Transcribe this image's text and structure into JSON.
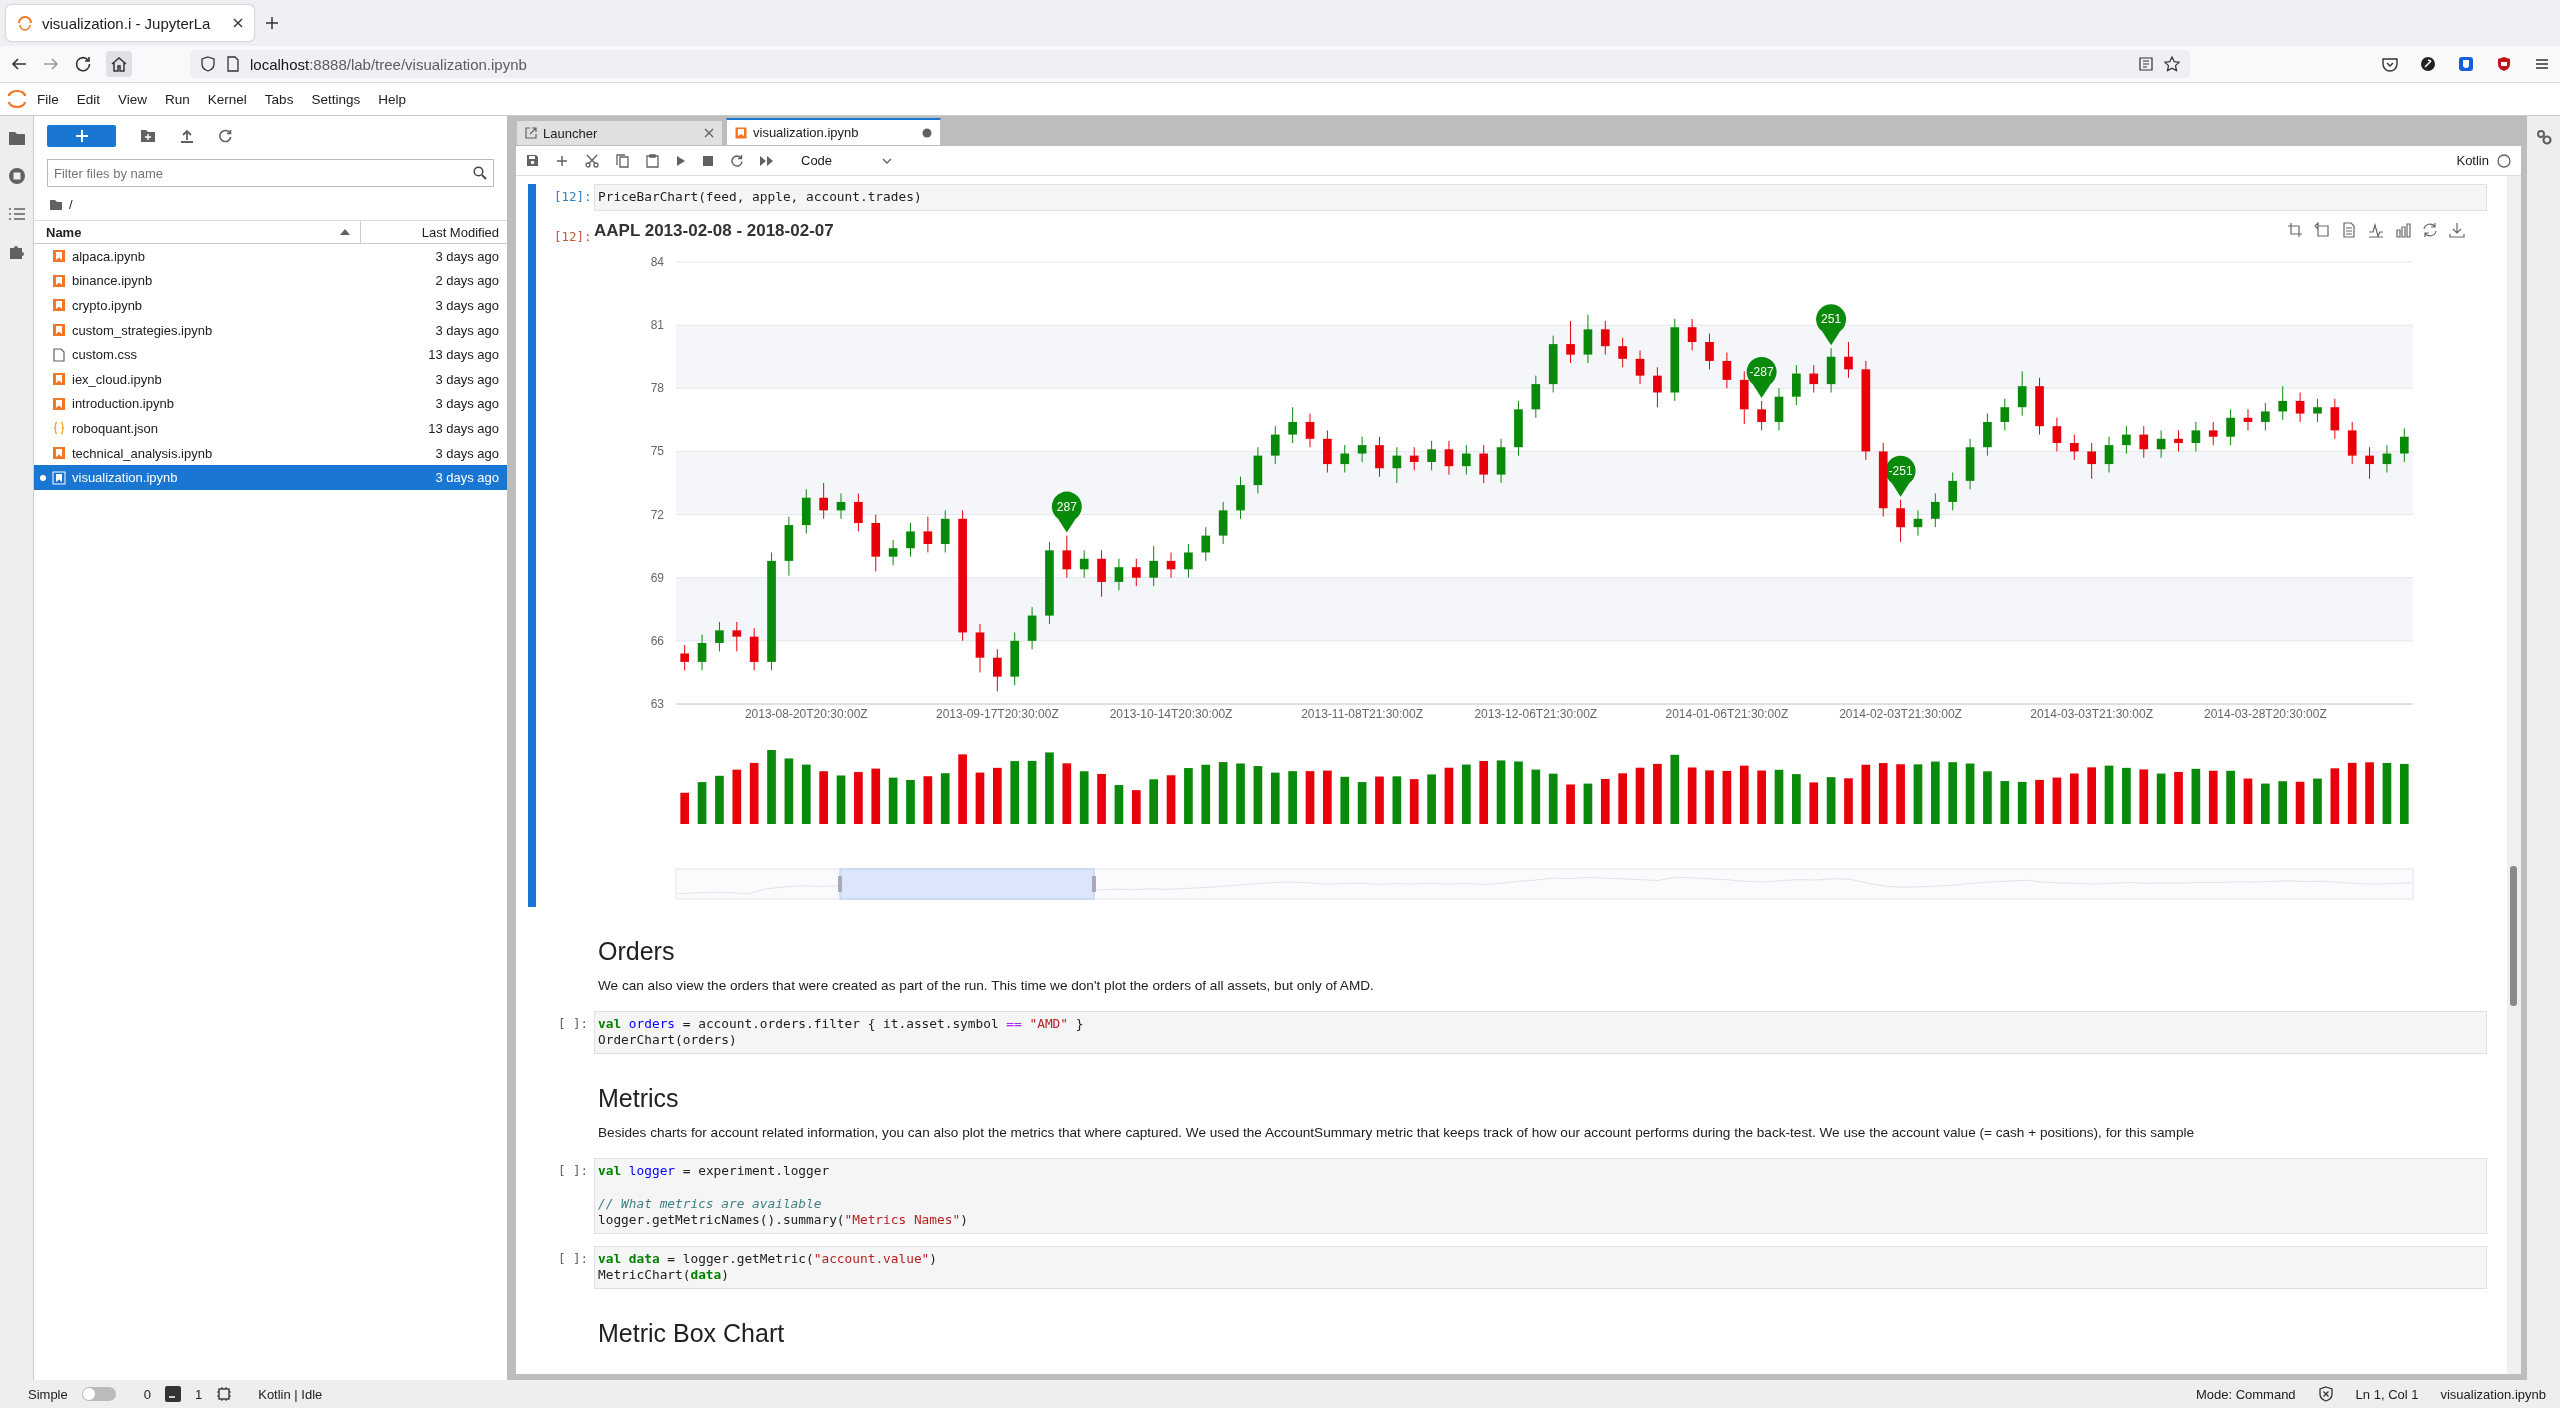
{
  "browser": {
    "tab_title": "visualization.i - JupyterLa",
    "url_host": "localhost",
    "url_path": ":8888/lab/tree/visualization.ipynb"
  },
  "menu": [
    "File",
    "Edit",
    "View",
    "Run",
    "Kernel",
    "Tabs",
    "Settings",
    "Help"
  ],
  "file_browser": {
    "filter_placeholder": "Filter files by name",
    "path": "/",
    "columns": [
      "Name",
      "Last Modified"
    ],
    "files": [
      {
        "name": "alpaca.ipynb",
        "modified": "3 days ago",
        "kind": "notebook",
        "selected": false
      },
      {
        "name": "binance.ipynb",
        "modified": "2 days ago",
        "kind": "notebook",
        "selected": false
      },
      {
        "name": "crypto.ipynb",
        "modified": "3 days ago",
        "kind": "notebook",
        "selected": false
      },
      {
        "name": "custom_strategies.ipynb",
        "modified": "3 days ago",
        "kind": "notebook",
        "selected": false
      },
      {
        "name": "custom.css",
        "modified": "13 days ago",
        "kind": "file",
        "selected": false
      },
      {
        "name": "iex_cloud.ipynb",
        "modified": "3 days ago",
        "kind": "notebook",
        "selected": false
      },
      {
        "name": "introduction.ipynb",
        "modified": "3 days ago",
        "kind": "notebook",
        "selected": false
      },
      {
        "name": "roboquant.json",
        "modified": "13 days ago",
        "kind": "json",
        "selected": false
      },
      {
        "name": "technical_analysis.ipynb",
        "modified": "3 days ago",
        "kind": "notebook",
        "selected": false
      },
      {
        "name": "visualization.ipynb",
        "modified": "3 days ago",
        "kind": "notebook",
        "selected": true
      }
    ]
  },
  "notebook_tabs": [
    {
      "label": "Launcher",
      "kind": "launcher",
      "selected": false
    },
    {
      "label": "visualization.ipynb",
      "kind": "notebook",
      "selected": true
    }
  ],
  "toolbar": {
    "cell_type": "Code",
    "kernel": "Kotlin"
  },
  "cells": [
    {
      "kind": "code",
      "prompt": "[12]:",
      "selected": true,
      "lines": [
        {
          "kind": "code",
          "tokens": [
            {
              "text": "PriceBarChart(feed, apple, account.trades)",
              "kind": "plain"
            }
          ]
        }
      ],
      "output": {
        "prompt": "[12]:",
        "chart_data": {
          "type": "candlestick",
          "title": "AAPL 2013-02-08 - 2018-02-07",
          "ylim": [
            63,
            84
          ],
          "yticks": [
            63,
            66,
            69,
            72,
            75,
            78,
            81,
            84
          ],
          "grid": true,
          "categories": [
            null,
            null,
            null,
            null,
            null,
            null,
            null,
            "2013-08-20T20:30:00Z",
            null,
            null,
            null,
            null,
            null,
            null,
            null,
            null,
            null,
            null,
            "2013-09-17T20:30:00Z",
            null,
            null,
            null,
            null,
            null,
            null,
            null,
            null,
            null,
            "2013-10-14T20:30:00Z",
            null,
            null,
            null,
            null,
            null,
            null,
            null,
            null,
            null,
            null,
            "2013-11-08T21:30:00Z",
            null,
            null,
            null,
            null,
            null,
            null,
            null,
            null,
            null,
            "2013-12-06T21:30:00Z",
            null,
            null,
            null,
            null,
            null,
            null,
            null,
            null,
            null,
            null,
            "2014-01-06T21:30:00Z",
            null,
            null,
            null,
            null,
            null,
            null,
            null,
            null,
            null,
            "2014-02-03T21:30:00Z",
            null,
            null,
            null,
            null,
            null,
            null,
            null,
            null,
            null,
            null,
            "2014-03-03T21:30:00Z",
            null,
            null,
            null,
            null,
            null,
            null,
            null,
            null,
            null,
            "2014-03-28T20:30:00Z",
            null,
            null,
            null,
            null,
            null,
            null,
            null,
            null
          ],
          "annotations": [
            "287",
            "-287",
            "251",
            "-251"
          ],
          "ohlc": [
            [
              65.4,
              65.8,
              64.6,
              65.0
            ],
            [
              65.0,
              66.3,
              64.6,
              65.9
            ],
            [
              65.9,
              66.9,
              65.5,
              66.5
            ],
            [
              66.5,
              66.9,
              65.5,
              66.2
            ],
            [
              66.2,
              66.6,
              64.6,
              65.0
            ],
            [
              65.0,
              70.2,
              64.6,
              69.8
            ],
            [
              69.8,
              71.9,
              69.1,
              71.5
            ],
            [
              71.5,
              73.2,
              71.1,
              72.8
            ],
            [
              72.8,
              73.5,
              71.8,
              72.2
            ],
            [
              72.2,
              73.0,
              71.8,
              72.6
            ],
            [
              72.6,
              73.0,
              71.2,
              71.6
            ],
            [
              71.6,
              72.0,
              69.3,
              70.0
            ],
            [
              70.0,
              70.8,
              69.6,
              70.4
            ],
            [
              70.4,
              71.6,
              70.0,
              71.2
            ],
            [
              71.2,
              71.9,
              70.2,
              70.6
            ],
            [
              70.6,
              72.2,
              70.2,
              71.8
            ],
            [
              71.8,
              72.2,
              66.0,
              66.4
            ],
            [
              66.4,
              66.8,
              64.5,
              65.2
            ],
            [
              65.2,
              65.6,
              63.6,
              64.3
            ],
            [
              64.3,
              66.4,
              63.9,
              66.0
            ],
            [
              66.0,
              67.6,
              65.6,
              67.2
            ],
            [
              67.2,
              70.7,
              66.8,
              70.3
            ],
            [
              70.3,
              71.0,
              69.0,
              69.4
            ],
            [
              69.4,
              70.3,
              69.0,
              69.9
            ],
            [
              69.9,
              70.3,
              68.1,
              68.8
            ],
            [
              68.8,
              69.9,
              68.4,
              69.5
            ],
            [
              69.5,
              69.9,
              68.6,
              69.0
            ],
            [
              69.0,
              70.5,
              68.6,
              69.8
            ],
            [
              69.8,
              70.2,
              69.0,
              69.4
            ],
            [
              69.4,
              70.6,
              69.0,
              70.2
            ],
            [
              70.2,
              71.4,
              69.8,
              71.0
            ],
            [
              71.0,
              72.6,
              70.6,
              72.2
            ],
            [
              72.2,
              73.8,
              71.8,
              73.4
            ],
            [
              73.4,
              75.2,
              73.0,
              74.8
            ],
            [
              74.8,
              76.2,
              74.4,
              75.8
            ],
            [
              75.8,
              77.1,
              75.4,
              76.4
            ],
            [
              76.4,
              76.8,
              75.2,
              75.6
            ],
            [
              75.6,
              76.0,
              74.0,
              74.4
            ],
            [
              74.4,
              75.3,
              74.0,
              74.9
            ],
            [
              74.9,
              75.7,
              74.5,
              75.3
            ],
            [
              75.3,
              75.7,
              73.8,
              74.2
            ],
            [
              74.2,
              75.2,
              73.5,
              74.8
            ],
            [
              74.8,
              75.2,
              74.1,
              74.5
            ],
            [
              74.5,
              75.5,
              74.1,
              75.1
            ],
            [
              75.1,
              75.5,
              73.9,
              74.3
            ],
            [
              74.3,
              75.3,
              73.9,
              74.9
            ],
            [
              74.9,
              75.3,
              73.5,
              73.9
            ],
            [
              73.9,
              75.6,
              73.5,
              75.2
            ],
            [
              75.2,
              77.4,
              74.8,
              77.0
            ],
            [
              77.0,
              78.6,
              76.6,
              78.2
            ],
            [
              78.2,
              80.5,
              77.8,
              80.1
            ],
            [
              80.1,
              81.2,
              79.2,
              79.6
            ],
            [
              79.6,
              81.5,
              79.2,
              80.8
            ],
            [
              80.8,
              81.2,
              79.6,
              80.0
            ],
            [
              80.0,
              80.4,
              79.0,
              79.4
            ],
            [
              79.4,
              79.8,
              78.2,
              78.6
            ],
            [
              78.6,
              79.0,
              77.1,
              77.8
            ],
            [
              77.8,
              81.3,
              77.4,
              80.9
            ],
            [
              80.9,
              81.3,
              79.8,
              80.2
            ],
            [
              80.2,
              80.6,
              78.9,
              79.3
            ],
            [
              79.3,
              79.7,
              78.0,
              78.4
            ],
            [
              78.4,
              78.8,
              76.3,
              77.0
            ],
            [
              77.0,
              77.4,
              76.0,
              76.4
            ],
            [
              76.4,
              78.0,
              76.0,
              77.6
            ],
            [
              77.6,
              79.1,
              77.2,
              78.7
            ],
            [
              78.7,
              79.1,
              77.8,
              78.2
            ],
            [
              78.2,
              79.9,
              77.8,
              79.5
            ],
            [
              79.5,
              80.2,
              78.5,
              78.9
            ],
            [
              78.9,
              79.3,
              74.6,
              75.0
            ],
            [
              75.0,
              75.4,
              71.9,
              72.3
            ],
            [
              72.3,
              72.7,
              70.7,
              71.4
            ],
            [
              71.4,
              72.2,
              71.0,
              71.8
            ],
            [
              71.8,
              73.0,
              71.4,
              72.6
            ],
            [
              72.6,
              74.0,
              72.2,
              73.6
            ],
            [
              73.6,
              75.6,
              73.2,
              75.2
            ],
            [
              75.2,
              76.8,
              74.8,
              76.4
            ],
            [
              76.4,
              77.5,
              76.0,
              77.1
            ],
            [
              77.1,
              78.8,
              76.7,
              78.1
            ],
            [
              78.1,
              78.5,
              75.8,
              76.2
            ],
            [
              76.2,
              76.6,
              75.0,
              75.4
            ],
            [
              75.4,
              75.8,
              74.6,
              75.0
            ],
            [
              75.0,
              75.4,
              73.7,
              74.4
            ],
            [
              74.4,
              75.7,
              74.0,
              75.3
            ],
            [
              75.3,
              76.2,
              74.9,
              75.8
            ],
            [
              75.8,
              76.2,
              74.7,
              75.1
            ],
            [
              75.1,
              76.0,
              74.7,
              75.6
            ],
            [
              75.6,
              76.0,
              75.0,
              75.4
            ],
            [
              75.4,
              76.4,
              75.0,
              76.0
            ],
            [
              76.0,
              76.4,
              75.3,
              75.7
            ],
            [
              75.7,
              77.0,
              75.3,
              76.6
            ],
            [
              76.6,
              77.0,
              76.0,
              76.4
            ],
            [
              76.4,
              77.3,
              76.0,
              76.9
            ],
            [
              76.9,
              78.1,
              76.5,
              77.4
            ],
            [
              77.4,
              77.8,
              76.4,
              76.8
            ],
            [
              76.8,
              77.5,
              76.4,
              77.1
            ],
            [
              77.1,
              77.5,
              75.6,
              76.0
            ],
            [
              76.0,
              76.4,
              74.4,
              74.8
            ],
            [
              74.8,
              75.2,
              73.7,
              74.4
            ],
            [
              74.4,
              75.3,
              74.0,
              74.9
            ],
            [
              74.9,
              76.1,
              74.5,
              75.7
            ]
          ]
        }
      }
    },
    {
      "kind": "heading",
      "text": "Orders"
    },
    {
      "kind": "paragraph",
      "text": "We can also view the orders that were created as part of the run. This time we don't plot the orders of all assets, but only of AMD."
    },
    {
      "kind": "code",
      "prompt": "[ ]:",
      "selected": false,
      "lines": [
        {
          "kind": "code",
          "tokens": [
            {
              "text": "val",
              "kind": "keyword"
            },
            {
              "text": " orders",
              "kind": "variable"
            },
            {
              "text": " = account.orders.filter { it.asset.symbol",
              "kind": "plain"
            },
            {
              "text": " ==",
              "kind": "operator"
            },
            {
              "text": " \"AMD\"",
              "kind": "string"
            },
            {
              "text": " }",
              "kind": "plain"
            }
          ]
        },
        {
          "kind": "code",
          "tokens": [
            {
              "text": "OrderChart(orders)",
              "kind": "plain"
            }
          ]
        }
      ]
    },
    {
      "kind": "heading",
      "text": "Metrics"
    },
    {
      "kind": "paragraph",
      "text": "Besides charts for account related information, you can also plot the metrics that where captured. We used the AccountSummary metric that keeps track of how our account performs during the back-test. We use the account value (= cash + positions), for this sample"
    },
    {
      "kind": "code",
      "prompt": "[ ]:",
      "selected": false,
      "lines": [
        {
          "kind": "code",
          "tokens": [
            {
              "text": "val",
              "kind": "keyword"
            },
            {
              "text": " logger",
              "kind": "variable"
            },
            {
              "text": " = experiment.logger",
              "kind": "plain"
            }
          ]
        },
        {
          "kind": "blank"
        },
        {
          "kind": "code",
          "tokens": [
            {
              "text": "// What metrics are available",
              "kind": "comment"
            }
          ]
        },
        {
          "kind": "code",
          "tokens": [
            {
              "text": "logger.getMetricNames().summary(",
              "kind": "plain"
            },
            {
              "text": "\"Metrics Names\"",
              "kind": "string"
            },
            {
              "text": ")",
              "kind": "plain"
            }
          ]
        }
      ]
    },
    {
      "kind": "code",
      "prompt": "[ ]:",
      "selected": false,
      "lines": [
        {
          "kind": "code",
          "tokens": [
            {
              "text": "val",
              "kind": "keyword"
            },
            {
              "text": " data",
              "kind": "keyword"
            },
            {
              "text": " = logger.getMetric(",
              "kind": "plain"
            },
            {
              "text": "\"account.value\"",
              "kind": "string"
            },
            {
              "text": ")",
              "kind": "plain"
            }
          ]
        },
        {
          "kind": "code",
          "tokens": [
            {
              "text": "MetricChart(",
              "kind": "plain"
            },
            {
              "text": "data",
              "kind": "keyword"
            },
            {
              "text": ")",
              "kind": "plain"
            }
          ]
        }
      ]
    },
    {
      "kind": "heading",
      "text": "Metric Box Chart"
    }
  ],
  "status_bar": {
    "simple_label": "Simple",
    "simple_on": false,
    "terminals": "0",
    "kernels": "1",
    "kernel_status": "Kotlin | Idle",
    "mode": "Mode: Command",
    "position": "Ln 1, Col 1",
    "file": "visualization.ipynb"
  }
}
